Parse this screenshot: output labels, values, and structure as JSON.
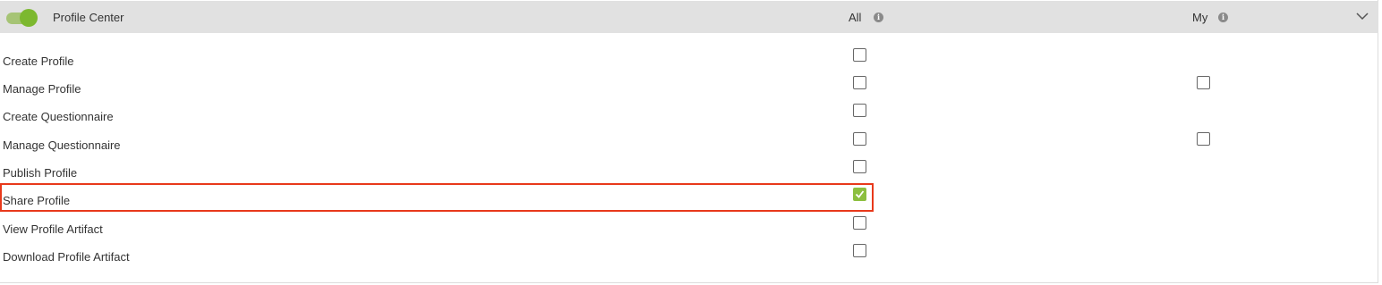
{
  "header": {
    "toggle_on": true,
    "title": "Profile Center",
    "col_all": "All",
    "col_my": "My",
    "info_glyph": "i"
  },
  "rows": [
    {
      "label": "Create Profile",
      "all": false,
      "my": null
    },
    {
      "label": "Manage Profile",
      "all": false,
      "my": false
    },
    {
      "label": "Create Questionnaire",
      "all": false,
      "my": null
    },
    {
      "label": "Manage Questionnaire",
      "all": false,
      "my": false
    },
    {
      "label": "Publish Profile",
      "all": false,
      "my": null
    },
    {
      "label": "Share Profile",
      "all": true,
      "my": null,
      "highlighted": true
    },
    {
      "label": "View Profile Artifact",
      "all": false,
      "my": null
    },
    {
      "label": "Download Profile Artifact",
      "all": false,
      "my": null
    }
  ],
  "colors": {
    "toggle_knob": "#7cb82f",
    "checked": "#8cbf3f",
    "highlight_border": "#e8391b",
    "header_bg": "#e1e1e1"
  },
  "icons": {
    "toggle": "toggle-switch-icon",
    "info": "info-icon",
    "collapse": "chevron-down-icon",
    "check": "checkmark-icon"
  }
}
